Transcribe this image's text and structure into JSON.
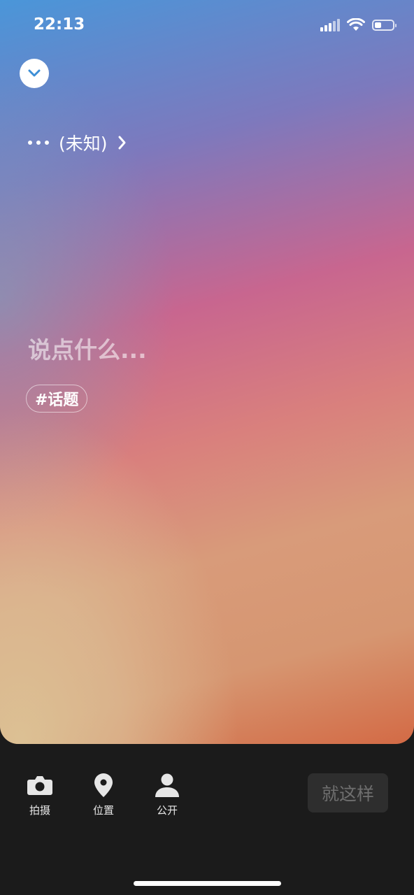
{
  "status_bar": {
    "time": "22:13"
  },
  "header": {
    "song_title": "(未知)"
  },
  "composer": {
    "placeholder": "说点什么...",
    "topic_chip": "#话题"
  },
  "toolbar": {
    "items": [
      {
        "label": "拍摄",
        "icon": "camera-icon"
      },
      {
        "label": "位置",
        "icon": "location-pin-icon"
      },
      {
        "label": "公开",
        "icon": "person-icon"
      }
    ],
    "submit_label": "就这样"
  },
  "colors": {
    "toolbar_bg": "#1b1b1b",
    "submit_bg": "#2e2e2e",
    "submit_text": "#6f6f6f",
    "gradient_top_left": "#4a96d9",
    "gradient_mid": "#c8668f",
    "gradient_bottom_right": "#d36a45"
  }
}
